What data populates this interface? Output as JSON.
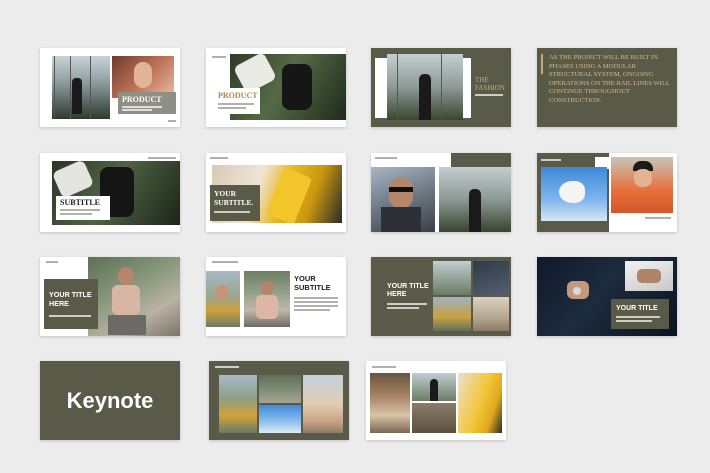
{
  "colors": {
    "background": "#ececec",
    "olive": "#5a5a48",
    "white": "#ffffff",
    "accent_yellow": "#e8b820"
  },
  "slides": {
    "s1": {
      "title": "PRODUCT"
    },
    "s2": {
      "title": "PRODUCT"
    },
    "s3": {
      "title_line1": "THE",
      "title_line2": "FASHION"
    },
    "s4": {
      "quote": "AS THE PROJECT WILL BE BUILT IN PHASES USING A MODULAR STRUCTURAL SYSTEM, ONGOING OPERATIONS ON THE RAIL LINES WILL CONTINUE THROUGHOUT CONSTRUCTION."
    },
    "s5": {
      "title": "SUBTITLE"
    },
    "s6": {
      "title_line1": "YOUR",
      "title_line2": "SUBTITLE."
    },
    "s9": {
      "title_line1": "YOUR TITLE",
      "title_line2": "HERE"
    },
    "s10": {
      "title_line1": "YOUR",
      "title_line2": "SUBTITLE"
    },
    "s11": {
      "title_line1": "YOUR TITLE",
      "title_line2": "HERE"
    },
    "s12": {
      "title": "YOUR TITLE"
    },
    "s13": {
      "label": "Keynote"
    }
  }
}
